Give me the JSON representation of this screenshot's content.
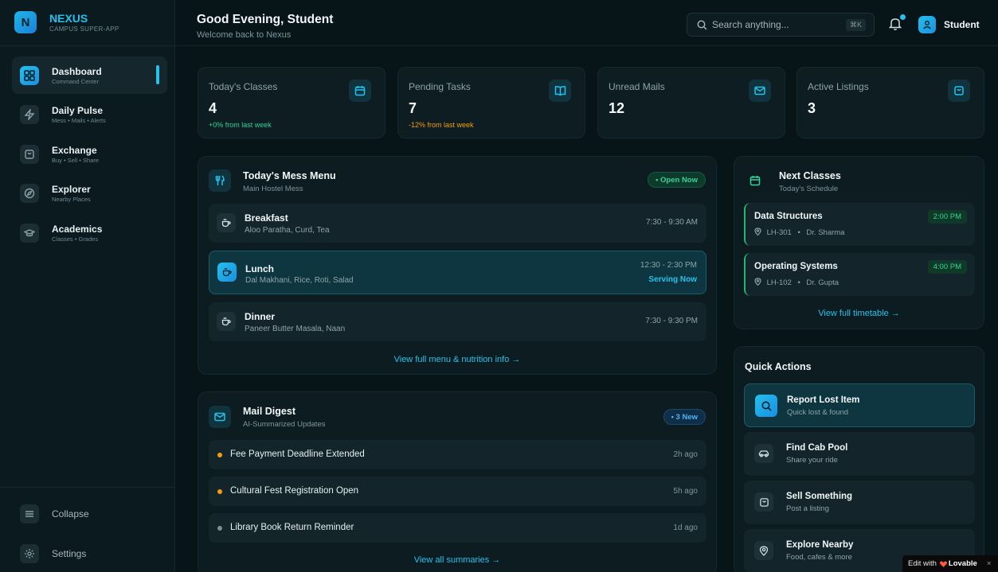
{
  "brand": {
    "logo_letter": "N",
    "name": "NEXUS",
    "tagline": "CAMPUS SUPER-APP"
  },
  "sidebar": {
    "items": [
      {
        "label": "Dashboard",
        "sub": "Command Center",
        "icon": "dashboard-grid-icon",
        "active": true
      },
      {
        "label": "Daily Pulse",
        "sub": "Mess • Mails • Alerts",
        "icon": "lightning-icon"
      },
      {
        "label": "Exchange",
        "sub": "Buy • Sell • Share",
        "icon": "shopping-bag-icon"
      },
      {
        "label": "Explorer",
        "sub": "Nearby Places",
        "icon": "compass-icon"
      },
      {
        "label": "Academics",
        "sub": "Classes • Grades",
        "icon": "graduation-cap-icon"
      }
    ],
    "collapse_label": "Collapse",
    "settings_label": "Settings"
  },
  "header": {
    "greeting": "Good Evening, Student",
    "subtitle": "Welcome back to Nexus",
    "search_placeholder": "Search anything...",
    "search_shortcut": "⌘K",
    "user_name": "Student"
  },
  "stats": [
    {
      "label": "Today's Classes",
      "value": "4",
      "trend": "+0% from last week",
      "trend_color": "#34d399",
      "icon": "calendar-icon"
    },
    {
      "label": "Pending Tasks",
      "value": "7",
      "trend": "-12% from last week",
      "trend_color": "#f59e0b",
      "icon": "book-open-icon"
    },
    {
      "label": "Unread Mails",
      "value": "12",
      "trend": "",
      "icon": "mail-icon"
    },
    {
      "label": "Active Listings",
      "value": "3",
      "trend": "",
      "icon": "shopping-bag-icon"
    }
  ],
  "mess": {
    "title": "Today's Mess Menu",
    "subtitle": "Main Hostel Mess",
    "badge": "• Open Now",
    "meals": [
      {
        "name": "Breakfast",
        "items": "Aloo Paratha, Curd, Tea",
        "time": "7:30 - 9:30 AM",
        "status": ""
      },
      {
        "name": "Lunch",
        "items": "Dal Makhani, Rice, Roti, Salad",
        "time": "12:30 - 2:30 PM",
        "status": "Serving Now"
      },
      {
        "name": "Dinner",
        "items": "Paneer Butter Masala, Naan",
        "time": "7:30 - 9:30 PM",
        "status": ""
      }
    ],
    "link": "View full menu & nutrition info →"
  },
  "mail": {
    "title": "Mail Digest",
    "subtitle": "AI-Summarized Updates",
    "badge": "• 3 New",
    "items": [
      {
        "subject": "Fee Payment Deadline Extended",
        "time": "2h ago",
        "dot_color": "#f59e0b"
      },
      {
        "subject": "Cultural Fest Registration Open",
        "time": "5h ago",
        "dot_color": "#f59e0b"
      },
      {
        "subject": "Library Book Return Reminder",
        "time": "1d ago",
        "dot_color": "#7d8f95"
      }
    ],
    "link": "View all summaries →"
  },
  "classes": {
    "title": "Next Classes",
    "subtitle": "Today's Schedule",
    "items": [
      {
        "name": "Data Structures",
        "room": "LH-301",
        "prof": "Dr. Sharma",
        "time": "2:00 PM"
      },
      {
        "name": "Operating Systems",
        "room": "LH-102",
        "prof": "Dr. Gupta",
        "time": "4:00 PM"
      }
    ],
    "separator": "•",
    "link": "View full timetable →"
  },
  "quick_actions": {
    "title": "Quick Actions",
    "items": [
      {
        "title": "Report Lost Item",
        "sub": "Quick lost & found",
        "icon": "search-icon"
      },
      {
        "title": "Find Cab Pool",
        "sub": "Share your ride",
        "icon": "car-icon"
      },
      {
        "title": "Sell Something",
        "sub": "Post a listing",
        "icon": "shopping-bag-icon"
      },
      {
        "title": "Explore Nearby",
        "sub": "Food, cafes & more",
        "icon": "map-pin-icon"
      }
    ]
  },
  "badge": {
    "prefix": "Edit with",
    "brand": "Lovable",
    "close": "×"
  },
  "colors": {
    "accent": "#22c3ee",
    "green": "#34d399",
    "amber": "#f59e0b",
    "bg": "#071418"
  }
}
